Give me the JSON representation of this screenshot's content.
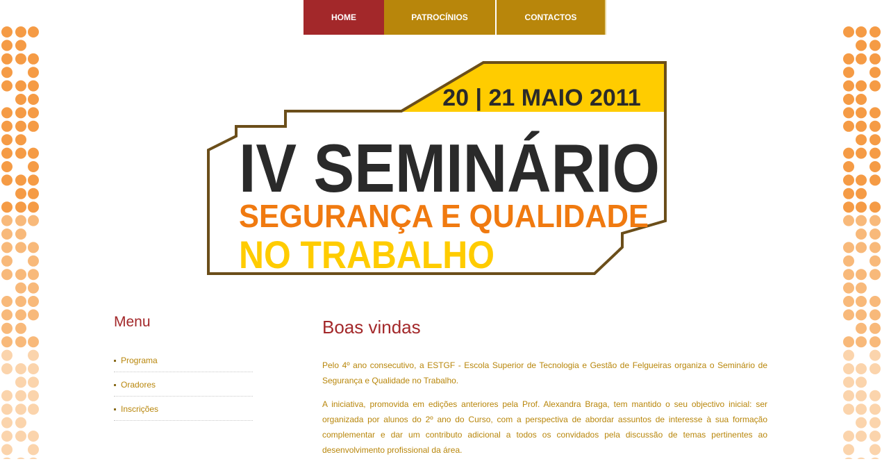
{
  "nav": {
    "items": [
      {
        "label": "HOME"
      },
      {
        "label": "PATROCÍNIOS"
      },
      {
        "label": "CONTACTOS"
      }
    ]
  },
  "banner": {
    "date": "20 | 21 MAIO 2011",
    "title": "IV SEMINÁRIO",
    "subtitle_line1": "SEGURANÇA E QUALIDADE",
    "subtitle_line2": "NO TRABALHO",
    "colors": {
      "frame": "#6b4e1a",
      "date_band": "#ffcc00",
      "title": "#2a2a2a",
      "subtitle1": "#f07a10",
      "subtitle2": "#ffcc00"
    }
  },
  "sidebar": {
    "title": "Menu",
    "items": [
      {
        "label": "Programa"
      },
      {
        "label": "Oradores"
      },
      {
        "label": "Inscrições"
      }
    ]
  },
  "main": {
    "heading": "Boas vindas",
    "paragraphs": [
      "Pelo 4º ano consecutivo, a ESTGF - Escola Superior de Tecnologia e Gestão de Felgueiras organiza o Seminário de Segurança e Qualidade no Trabalho.",
      "A iniciativa, promovida em edições anteriores pela Prof. Alexandra Braga, tem mantido o seu objectivo inicial: ser organizada por alunos do 2º ano do Curso, com a perspectiva de abordar assuntos de interesse à sua formação complementar e dar um contributo adicional a todos os convidados pela discussão de temas pertinentes ao desenvolvimento profissional da área."
    ]
  },
  "theme": {
    "accent_red": "#a3282a",
    "accent_gold": "#b8860b",
    "dot_colors": [
      "#f59b45",
      "#f8b97a",
      "#fbd4ac"
    ]
  }
}
